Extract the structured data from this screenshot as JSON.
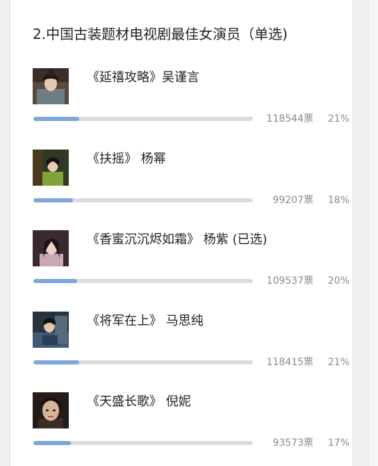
{
  "question": {
    "title": "2.中国古装题材电视剧最佳女演员（单选)"
  },
  "colors": {
    "bar_fill": "#7ea6dc",
    "bar_track": "#dcdcdc",
    "meta_text": "#8a8a8a"
  },
  "options": [
    {
      "label": "《延禧攻略》吴谨言",
      "votes": "118544票",
      "percent": "21%",
      "share": 0.21,
      "thumb": "portrait-photo-icon"
    },
    {
      "label": "《扶摇》 杨幂",
      "votes": "99207票",
      "percent": "18%",
      "share": 0.18,
      "thumb": "portrait-photo-icon"
    },
    {
      "label": "《香蜜沉沉烬如霜》 杨紫 (已选)",
      "votes": "109537票",
      "percent": "20%",
      "share": 0.2,
      "thumb": "portrait-photo-icon"
    },
    {
      "label": "《将军在上》 马思纯",
      "votes": "118415票",
      "percent": "21%",
      "share": 0.21,
      "thumb": "portrait-photo-icon"
    },
    {
      "label": "《天盛长歌》 倪妮",
      "votes": "93573票",
      "percent": "17%",
      "share": 0.17,
      "thumb": "portrait-photo-icon"
    }
  ]
}
